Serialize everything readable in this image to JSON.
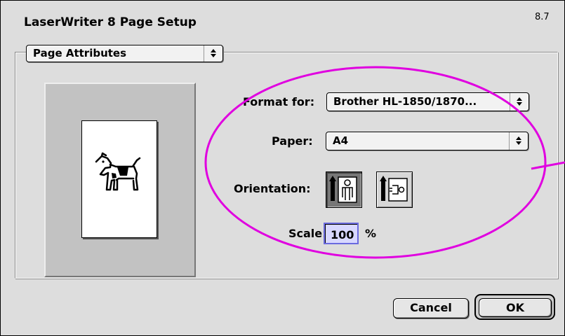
{
  "window": {
    "title": "LaserWriter 8 Page Setup",
    "version": "8.7"
  },
  "section_popup": {
    "value": "Page Attributes"
  },
  "form": {
    "format_for_label": "Format for:",
    "format_for_value": "Brother HL-1850/1870...",
    "paper_label": "Paper:",
    "paper_value": "A4",
    "orientation_label": "Orientation:",
    "orientation_options": [
      "portrait",
      "landscape"
    ],
    "orientation_selected": "portrait",
    "scale_label": "Scale:",
    "scale_value": "100",
    "scale_unit": "%"
  },
  "buttons": {
    "cancel": "Cancel",
    "ok": "OK"
  },
  "colors": {
    "annotation": "#e000e0",
    "scale_field_bg": "#d8d8ff"
  },
  "icons": [
    "popup-arrows-icon",
    "dogcow-icon",
    "portrait-orientation-icon",
    "landscape-orientation-icon"
  ]
}
